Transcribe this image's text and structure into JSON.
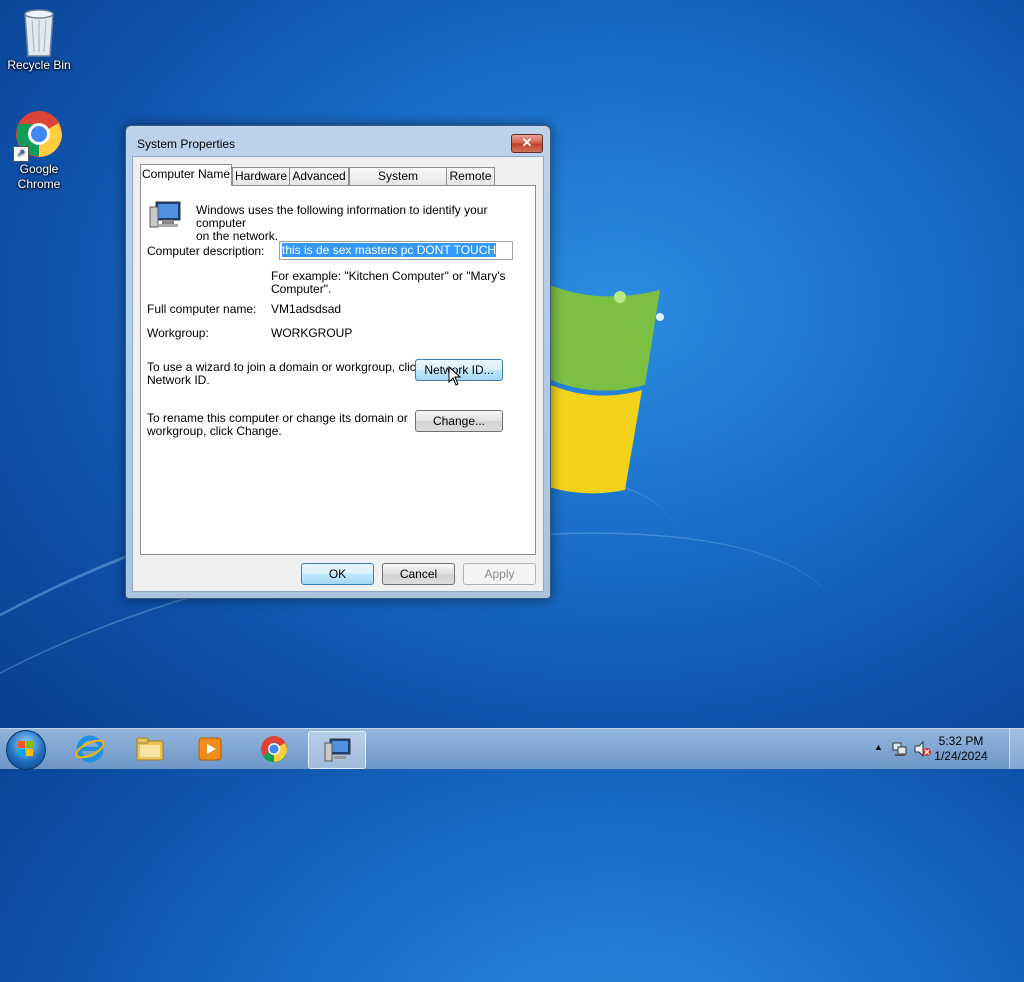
{
  "desktop": {
    "icons": [
      {
        "label": "Recycle Bin",
        "icon": "recycle-bin-icon"
      },
      {
        "label": "Google Chrome",
        "label_line1": "Google",
        "label_line2": "Chrome",
        "icon": "chrome-icon"
      }
    ]
  },
  "dialog": {
    "title": "System Properties",
    "close_label": "✕",
    "tabs": [
      {
        "label": "Computer Name",
        "active": true
      },
      {
        "label": "Hardware",
        "active": false
      },
      {
        "label": "Advanced",
        "active": false
      },
      {
        "label": "System Protection",
        "active": false
      },
      {
        "label": "Remote",
        "active": false
      }
    ],
    "intro_line1": "Windows uses the following information to identify your computer",
    "intro_line2": "on the network.",
    "description_label": "Computer description:",
    "description_value": "this is de sex masters pc DONT TOUCH",
    "example_line1": "For example: \"Kitchen Computer\" or \"Mary's",
    "example_line2": "Computer\".",
    "full_name_label": "Full computer name:",
    "full_name_value": "VM1adsdsad",
    "workgroup_label": "Workgroup:",
    "workgroup_value": "WORKGROUP",
    "wizard_line1": "To use a wizard to join a domain or workgroup, click",
    "wizard_line2": "Network ID.",
    "network_id_button": "Network ID...",
    "rename_line1": "To rename this computer or change its domain or",
    "rename_line2": "workgroup, click Change.",
    "change_button": "Change...",
    "ok_button": "OK",
    "cancel_button": "Cancel",
    "apply_button": "Apply"
  },
  "taskbar": {
    "items": [
      "start-orb",
      "internet-explorer-icon",
      "file-explorer-icon",
      "media-player-icon",
      "chrome-icon",
      "system-properties-icon"
    ],
    "clock_time": "5:32 PM",
    "clock_date": "1/24/2024"
  },
  "colors": {
    "selection": "#3399ff",
    "title_bar": "#bcd3ea",
    "close_button": "#c0402a"
  }
}
